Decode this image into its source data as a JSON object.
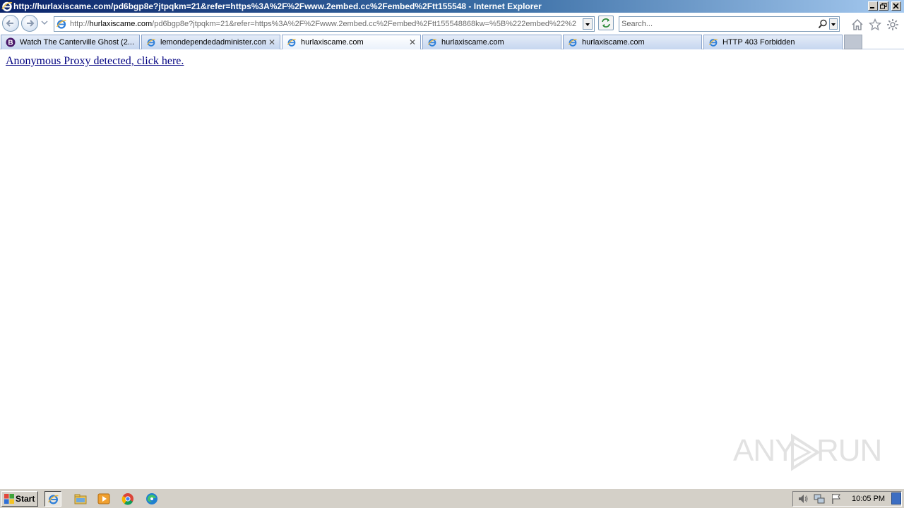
{
  "window": {
    "title": "http://hurlaxiscame.com/pd6bgp8e?jtpqkm=21&refer=https%3A%2F%2Fwww.2embed.cc%2Fembed%2Ftt155548 - Internet Explorer"
  },
  "address": {
    "prefix": "http://",
    "host": "hurlaxiscame.com",
    "path": "/pd6bgp8e?jtpqkm=21&refer=https%3A%2F%2Fwww.2embed.cc%2Fembed%2Ftt155548868kw=%5B%222embed%22%2"
  },
  "search": {
    "placeholder": "Search..."
  },
  "tabs": [
    {
      "label": "Watch The Canterville Ghost (2...",
      "icon": "site-favicon-icon",
      "active": false,
      "closable": false
    },
    {
      "label": "lemondependedadminister.com",
      "icon": "ie-page-icon",
      "active": false,
      "closable": true
    },
    {
      "label": "hurlaxiscame.com",
      "icon": "ie-page-icon",
      "active": true,
      "closable": true
    },
    {
      "label": "hurlaxiscame.com",
      "icon": "ie-page-icon",
      "active": false,
      "closable": false
    },
    {
      "label": "hurlaxiscame.com",
      "icon": "ie-page-icon",
      "active": false,
      "closable": false
    },
    {
      "label": "HTTP 403 Forbidden",
      "icon": "ie-page-icon",
      "active": false,
      "closable": false
    }
  ],
  "page": {
    "link_text": "Anonymous Proxy detected, click here."
  },
  "watermark": {
    "left": "ANY",
    "right": "RUN"
  },
  "taskbar": {
    "start_label": "Start",
    "clock": "10:05 PM"
  },
  "colors": {
    "titlebar_start": "#0a246a",
    "titlebar_end": "#a6caf0",
    "link": "#000080",
    "taskbar": "#d4d0c8"
  }
}
